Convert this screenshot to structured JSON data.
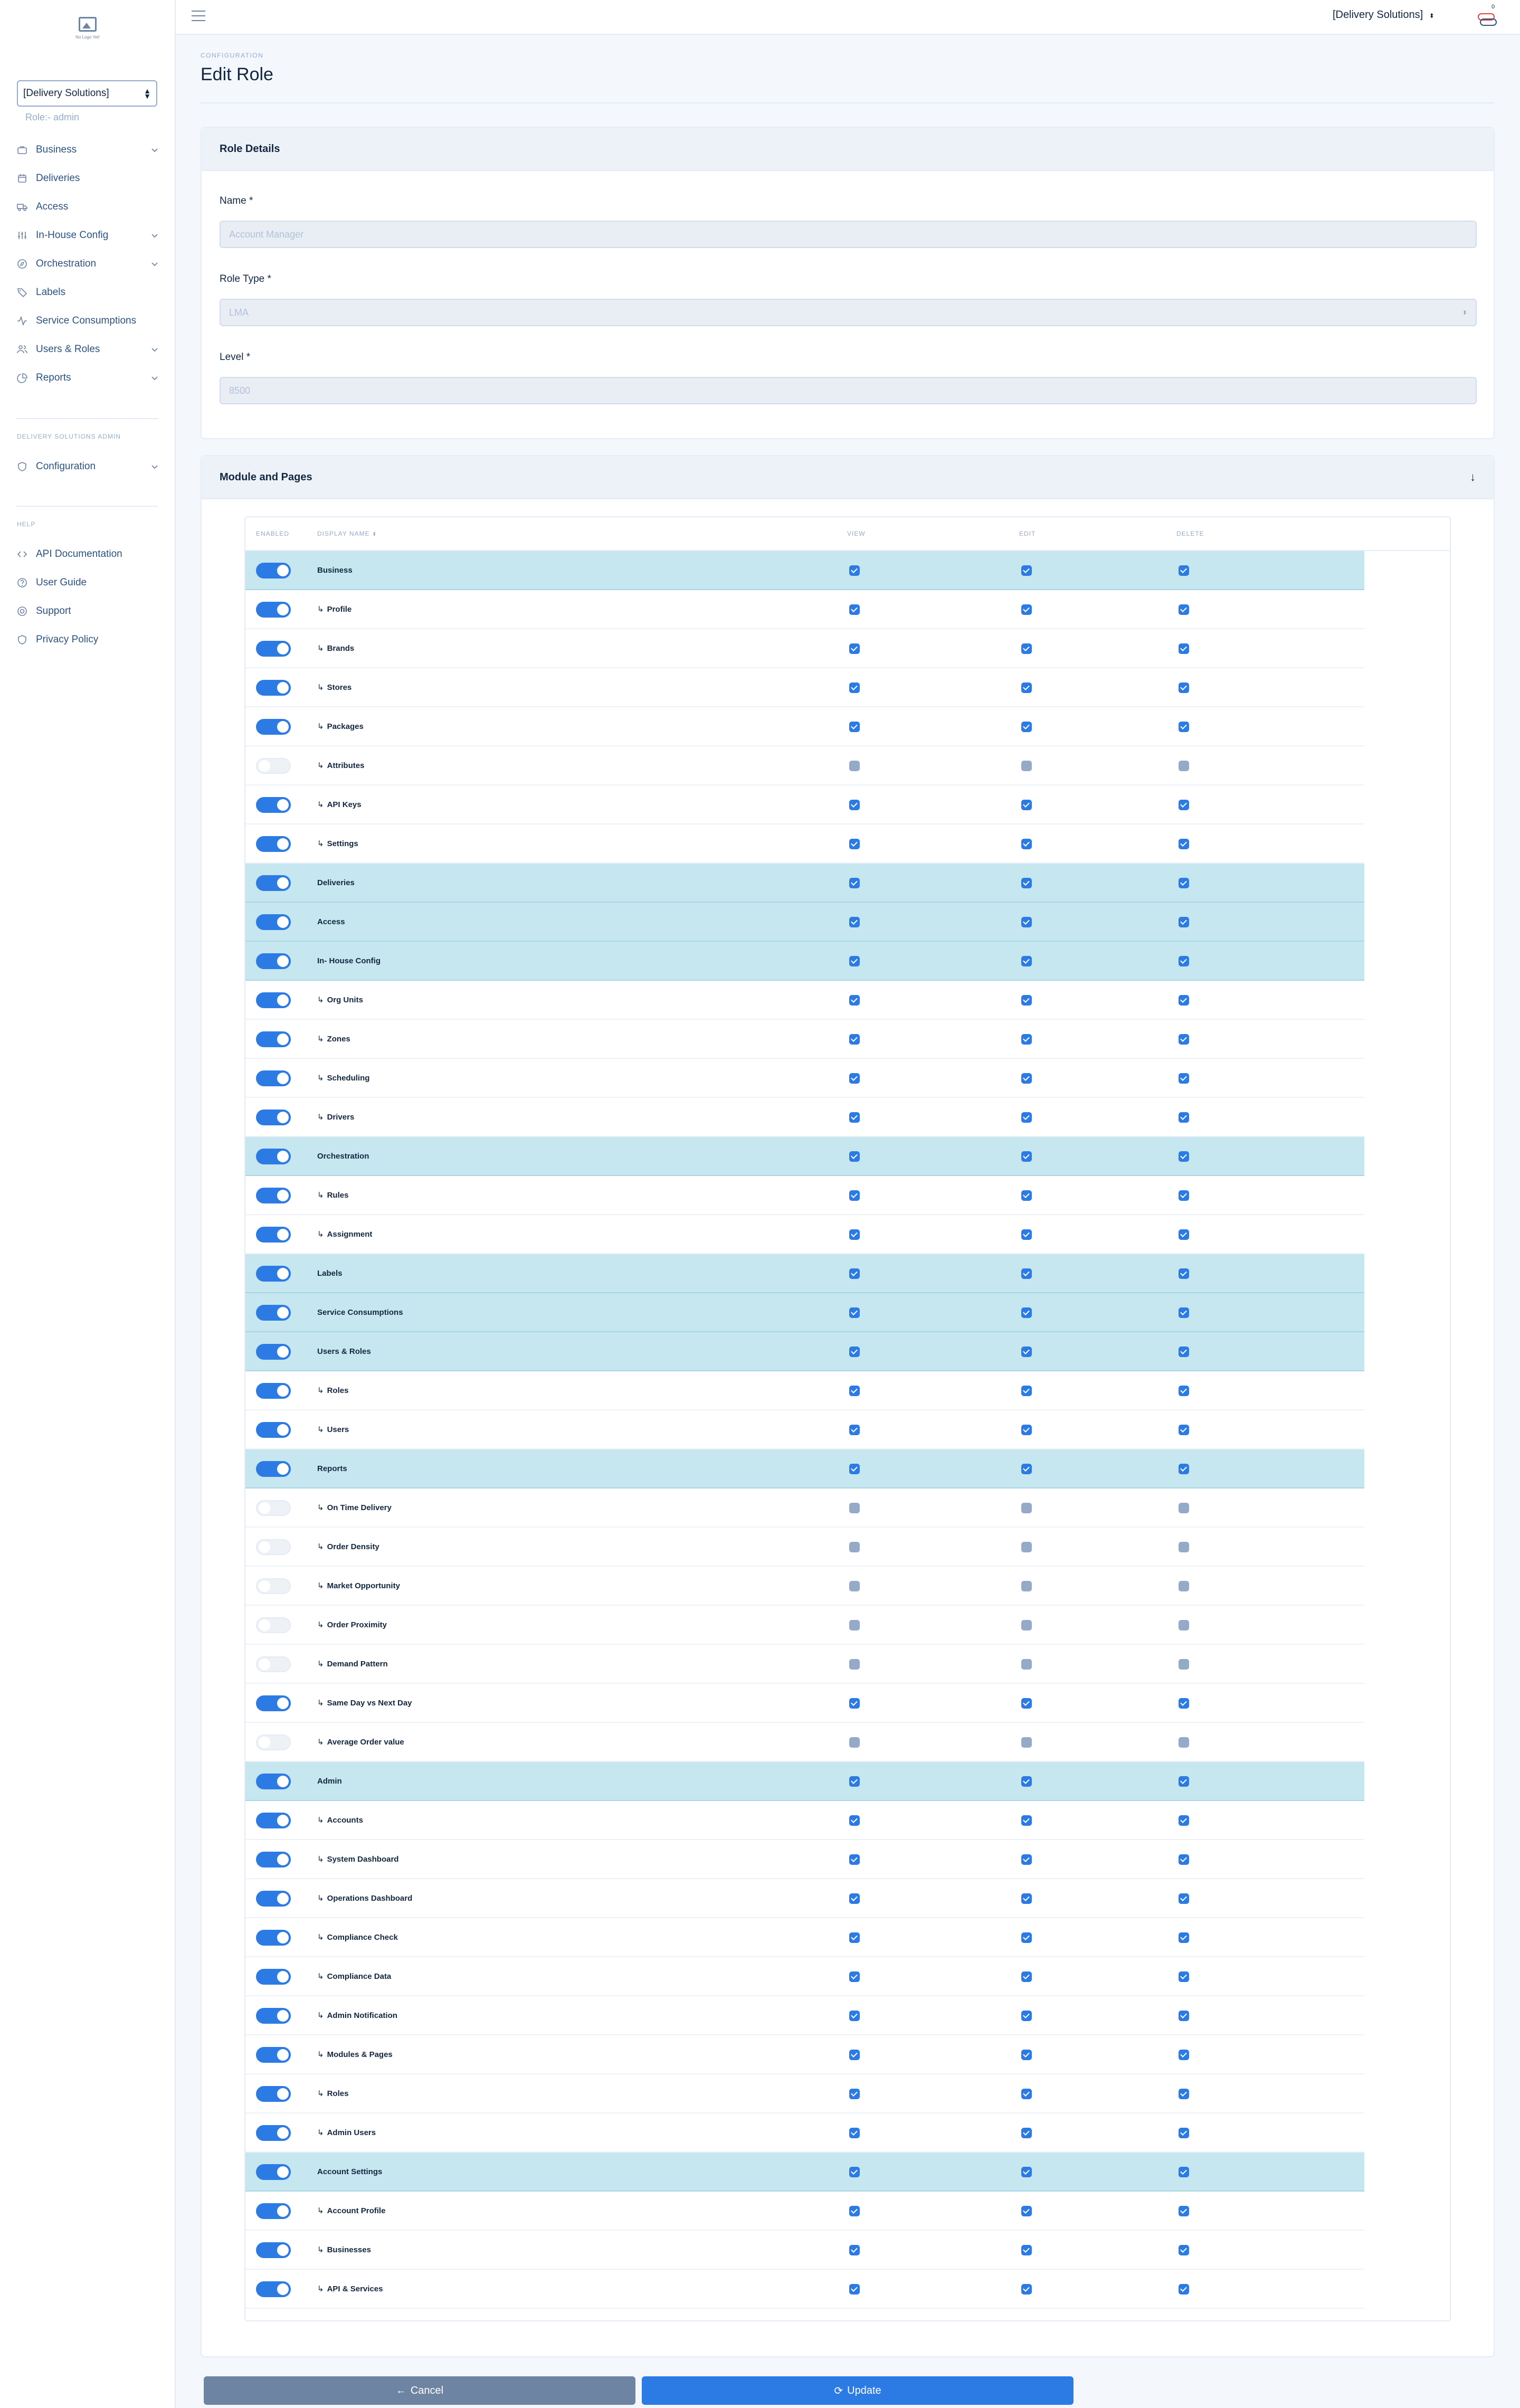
{
  "sidebar": {
    "logo_caption": "No Logo Yet!",
    "account_select": "[Delivery Solutions]",
    "role_line": "Role:- admin",
    "nav": [
      {
        "label": "Business",
        "icon": "briefcase-icon",
        "chevron": true
      },
      {
        "label": "Deliveries",
        "icon": "calendar-icon",
        "chevron": false
      },
      {
        "label": "Access",
        "icon": "truck-icon",
        "chevron": false
      },
      {
        "label": "In-House Config",
        "icon": "sliders-icon",
        "chevron": true
      },
      {
        "label": "Orchestration",
        "icon": "compass-icon",
        "chevron": true
      },
      {
        "label": "Labels",
        "icon": "tag-icon",
        "chevron": false
      },
      {
        "label": "Service Consumptions",
        "icon": "activity-icon",
        "chevron": false
      },
      {
        "label": "Users & Roles",
        "icon": "users-icon",
        "chevron": true
      },
      {
        "label": "Reports",
        "icon": "pie-chart-icon",
        "chevron": true
      }
    ],
    "admin_heading": "DELIVERY SOLUTIONS ADMIN",
    "admin_nav": [
      {
        "label": "Configuration",
        "icon": "shield-icon",
        "chevron": true
      }
    ],
    "help_heading": "HELP",
    "help_nav": [
      {
        "label": "API Documentation",
        "icon": "code-icon"
      },
      {
        "label": "User Guide",
        "icon": "help-circle-icon"
      },
      {
        "label": "Support",
        "icon": "life-buoy-icon"
      },
      {
        "label": "Privacy Policy",
        "icon": "shield-icon"
      }
    ]
  },
  "topbar": {
    "account": "[Delivery Solutions]",
    "notification_count": "0"
  },
  "header": {
    "pretitle": "CONFIGURATION",
    "title": "Edit Role"
  },
  "role_details": {
    "title": "Role Details",
    "name_label": "Name *",
    "name_value": "Account Manager",
    "type_label": "Role Type *",
    "type_value": "LMA",
    "level_label": "Level *",
    "level_value": "8500"
  },
  "modules": {
    "title": "Module and Pages",
    "columns": {
      "enabled": "ENABLED",
      "display_name": "DISPLAY NAME",
      "view": "VIEW",
      "edit": "EDIT",
      "delete": "DELETE"
    },
    "rows": [
      {
        "name": "Business",
        "parent": true,
        "enabled": true
      },
      {
        "name": "Profile",
        "parent": false,
        "enabled": true
      },
      {
        "name": "Brands",
        "parent": false,
        "enabled": true
      },
      {
        "name": "Stores",
        "parent": false,
        "enabled": true
      },
      {
        "name": "Packages",
        "parent": false,
        "enabled": true
      },
      {
        "name": "Attributes",
        "parent": false,
        "enabled": false
      },
      {
        "name": "API Keys",
        "parent": false,
        "enabled": true
      },
      {
        "name": "Settings",
        "parent": false,
        "enabled": true
      },
      {
        "name": "Deliveries",
        "parent": true,
        "enabled": true
      },
      {
        "name": "Access",
        "parent": true,
        "enabled": true
      },
      {
        "name": "In- House Config",
        "parent": true,
        "enabled": true
      },
      {
        "name": "Org Units",
        "parent": false,
        "enabled": true
      },
      {
        "name": "Zones",
        "parent": false,
        "enabled": true
      },
      {
        "name": "Scheduling",
        "parent": false,
        "enabled": true
      },
      {
        "name": "Drivers",
        "parent": false,
        "enabled": true
      },
      {
        "name": "Orchestration",
        "parent": true,
        "enabled": true
      },
      {
        "name": "Rules",
        "parent": false,
        "enabled": true
      },
      {
        "name": "Assignment",
        "parent": false,
        "enabled": true
      },
      {
        "name": "Labels",
        "parent": true,
        "enabled": true
      },
      {
        "name": "Service Consumptions",
        "parent": true,
        "enabled": true
      },
      {
        "name": "Users & Roles",
        "parent": true,
        "enabled": true
      },
      {
        "name": "Roles",
        "parent": false,
        "enabled": true
      },
      {
        "name": "Users",
        "parent": false,
        "enabled": true
      },
      {
        "name": "Reports",
        "parent": true,
        "enabled": true
      },
      {
        "name": "On Time Delivery",
        "parent": false,
        "enabled": false
      },
      {
        "name": "Order Density",
        "parent": false,
        "enabled": false
      },
      {
        "name": "Market Opportunity",
        "parent": false,
        "enabled": false
      },
      {
        "name": "Order Proximity",
        "parent": false,
        "enabled": false
      },
      {
        "name": "Demand Pattern",
        "parent": false,
        "enabled": false
      },
      {
        "name": "Same Day vs Next Day",
        "parent": false,
        "enabled": true
      },
      {
        "name": "Average Order value",
        "parent": false,
        "enabled": false
      },
      {
        "name": "Admin",
        "parent": true,
        "enabled": true
      },
      {
        "name": "Accounts",
        "parent": false,
        "enabled": true
      },
      {
        "name": "System Dashboard",
        "parent": false,
        "enabled": true
      },
      {
        "name": "Operations Dashboard",
        "parent": false,
        "enabled": true
      },
      {
        "name": "Compliance Check",
        "parent": false,
        "enabled": true
      },
      {
        "name": "Compliance Data",
        "parent": false,
        "enabled": true
      },
      {
        "name": "Admin Notification",
        "parent": false,
        "enabled": true
      },
      {
        "name": "Modules & Pages",
        "parent": false,
        "enabled": true
      },
      {
        "name": "Roles",
        "parent": false,
        "enabled": true
      },
      {
        "name": "Admin Users",
        "parent": false,
        "enabled": true
      },
      {
        "name": "Account Settings",
        "parent": true,
        "enabled": true
      },
      {
        "name": "Account Profile",
        "parent": false,
        "enabled": true
      },
      {
        "name": "Businesses",
        "parent": false,
        "enabled": true
      },
      {
        "name": "API & Services",
        "parent": false,
        "enabled": true
      }
    ]
  },
  "buttons": {
    "cancel": "Cancel",
    "update": "Update"
  },
  "colors": {
    "accent": "#2c7be5",
    "parent_row": "#c7e7f0",
    "muted": "#95aac9"
  }
}
